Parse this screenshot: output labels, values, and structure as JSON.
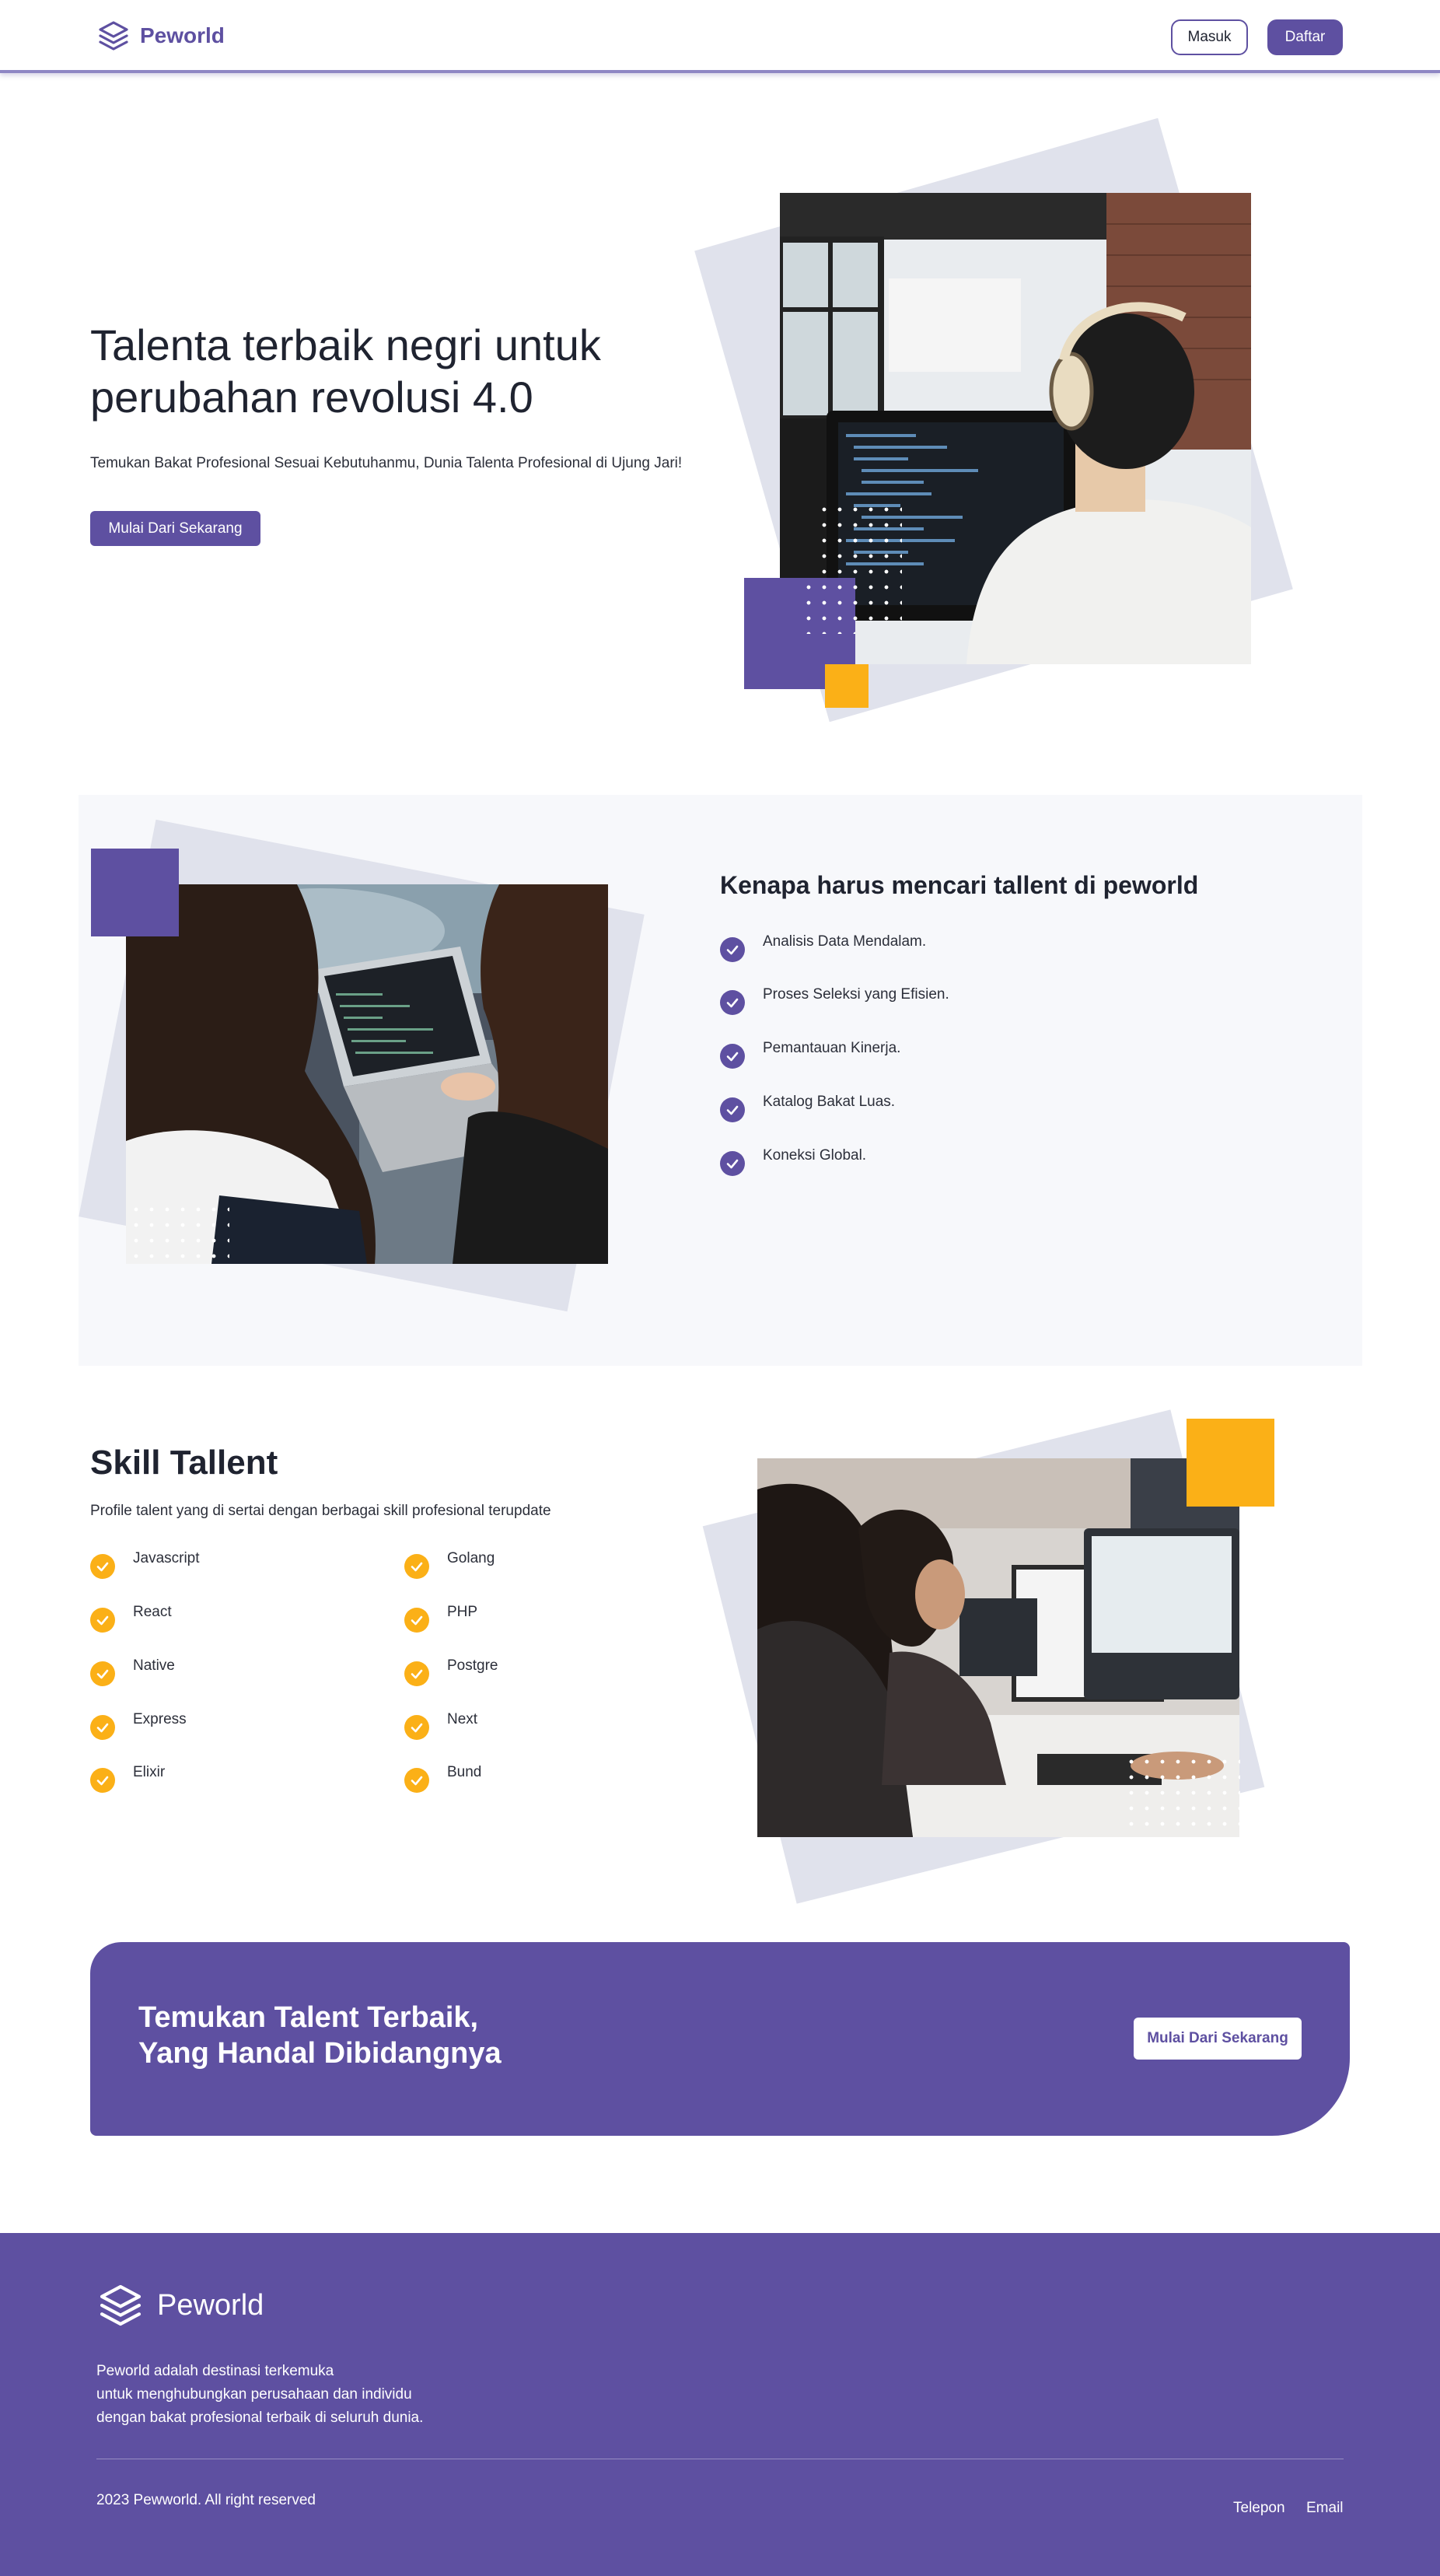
{
  "navbar": {
    "brand": "Peworld",
    "login_label": "Masuk",
    "register_label": "Daftar"
  },
  "hero": {
    "title": "Talenta terbaik negri untuk perubahan revolusi 4.0",
    "subtitle": "Temukan Bakat Profesional Sesuai Kebutuhanmu, Dunia Talenta Profesional di Ujung Jari!",
    "cta_label": "Mulai Dari Sekarang"
  },
  "why": {
    "title": "Kenapa harus mencari tallent di peworld",
    "items": [
      "Analisis Data Mendalam.",
      "Proses Seleksi yang Efisien.",
      "Pemantauan Kinerja.",
      "Katalog Bakat Luas.",
      "Koneksi Global."
    ]
  },
  "skills": {
    "title": "Skill Tallent",
    "subtitle": "Profile talent yang di sertai dengan berbagai skill profesional terupdate",
    "left": [
      "Javascript",
      "React",
      "Native",
      "Express",
      "Elixir"
    ],
    "right": [
      "Golang",
      "PHP",
      "Postgre",
      "Next",
      "Bund"
    ]
  },
  "cta_band": {
    "line1": "Temukan Talent Terbaik,",
    "line2": "Yang Handal Dibidangnya",
    "button_label": "Mulai Dari Sekarang"
  },
  "footer": {
    "brand": "Peworld",
    "desc_line1": "Peworld adalah destinasi terkemuka",
    "desc_line2": "untuk menghubungkan perusahaan dan individu",
    "desc_line3": "dengan bakat profesional terbaik di seluruh dunia.",
    "copyright": "2023 Pewworld. All right reserved",
    "link_phone": "Telepon",
    "link_email": "Email"
  },
  "colors": {
    "primary": "#5e50a1",
    "accent": "#fbb017",
    "section_bg": "#f7f8fb"
  }
}
